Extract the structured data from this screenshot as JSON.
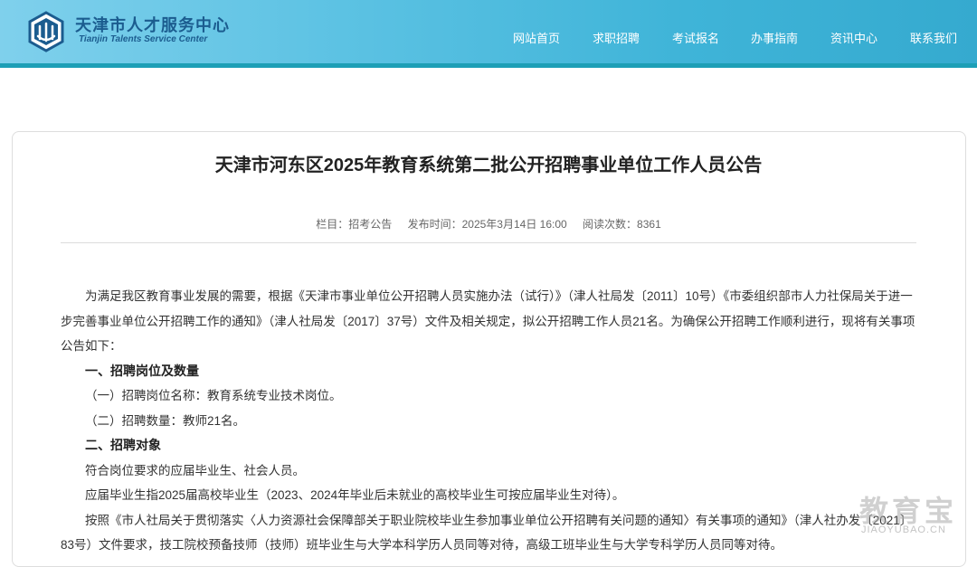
{
  "header": {
    "brand_cn": "天津市人才服务中心",
    "brand_en": "Tianjin Talents Service Center",
    "nav": [
      "网站首页",
      "求职招聘",
      "考试报名",
      "办事指南",
      "资讯中心",
      "联系我们"
    ]
  },
  "article": {
    "title": "天津市河东区2025年教育系统第二批公开招聘事业单位工作人员公告",
    "meta": {
      "column": "栏目：招考公告",
      "published": "发布时间：2025年3月14日 16:00",
      "views": "阅读次数：8361"
    },
    "paragraphs": [
      "为满足我区教育事业发展的需要，根据《天津市事业单位公开招聘人员实施办法（试行）》（津人社局发〔2011〕10号）《市委组织部市人力社保局关于进一步完善事业单位公开招聘工作的通知》（津人社局发〔2017〕37号）文件及相关规定，拟公开招聘工作人员21名。为确保公开招聘工作顺利进行，现将有关事项公告如下：",
      "一、招聘岗位及数量",
      "（一）招聘岗位名称：教育系统专业技术岗位。",
      "（二）招聘数量：教师21名。",
      "二、招聘对象",
      "符合岗位要求的应届毕业生、社会人员。",
      "应届毕业生指2025届高校毕业生（2023、2024年毕业后未就业的高校毕业生可按应届毕业生对待）。",
      "按照《市人社局关于贯彻落实〈人力资源社会保障部关于职业院校毕业生参加事业单位公开招聘有关问题的通知〉有关事项的通知》（津人社办发〔2021〕83号）文件要求，技工院校预备技师（技师）班毕业生与大学本科学历人员同等对待，高级工班毕业生与大学专科学历人员同等对待。"
    ]
  },
  "watermark": {
    "main": "教育宝",
    "sub": "JIAOYUBAO.CN"
  },
  "colors": {
    "header_start": "#7fd0ec",
    "header_end": "#35aacf",
    "header_bar": "#1d9fb6",
    "brand": "#1b5c8f"
  }
}
